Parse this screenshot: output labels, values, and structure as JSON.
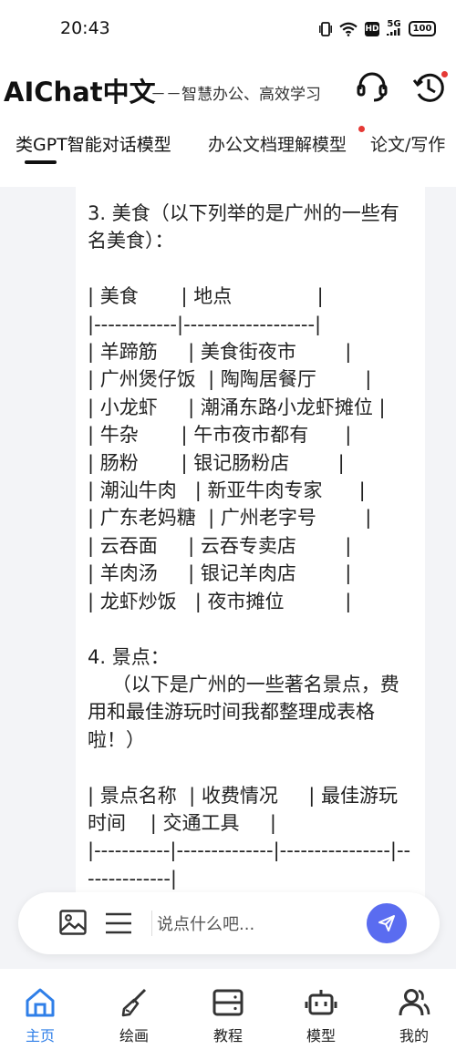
{
  "status_bar": {
    "time": "20:43",
    "network": "5G",
    "hd": "HD",
    "battery": "100"
  },
  "header": {
    "title": "AIChat中文",
    "subtitle": "－－智慧办公、高效学习",
    "service_icon": "headset-icon",
    "history_icon": "history-icon"
  },
  "tabs": [
    {
      "label": "类GPT智能对话模型",
      "active": true
    },
    {
      "label": "办公文档理解模型",
      "badge": true
    },
    {
      "label": "论文/写作"
    }
  ],
  "chat": {
    "message": "3. 美食（以下列举的是广州的一些有名美食）：\n\n| 美食       | 地点              |\n|------------|-------------------|\n| 羊蹄筋     | 美食街夜市        |\n| 广州煲仔饭  | 陶陶居餐厅        |\n| 小龙虾     | 潮涌东路小龙虾摊位 |\n| 牛杂       | 午市夜市都有      |\n| 肠粉       | 银记肠粉店        |\n| 潮汕牛肉   | 新亚牛肉专家      |\n| 广东老妈糖  | 广州老字号        |\n| 云吞面     | 云吞专卖店        |\n| 羊肉汤     | 银记羊肉店        |\n| 龙虾炒饭   | 夜市摊位          |\n\n4. 景点：\n    （以下是广州的一些著名景点，费用和最佳游玩时间我都整理成表格啦！）\n\n| 景点名称  | 收费情况     | 最佳游玩时间    | 交通工具     |\n|-----------|--------------|----------------|--------------|"
  },
  "input": {
    "placeholder": "说点什么吧...",
    "image_icon": "image-icon",
    "menu_icon": "list-icon",
    "send_icon": "send-icon"
  },
  "nav": [
    {
      "label": "主页",
      "icon": "home-icon",
      "active": true
    },
    {
      "label": "绘画",
      "icon": "brush-icon"
    },
    {
      "label": "教程",
      "icon": "course-icon"
    },
    {
      "label": "模型",
      "icon": "robot-icon"
    },
    {
      "label": "我的",
      "icon": "user-icon"
    }
  ],
  "colors": {
    "accent": "#2f7fe8",
    "send": "#5a6cf0",
    "chat_bg": "#f3f4f7",
    "badge": "#e53935"
  }
}
